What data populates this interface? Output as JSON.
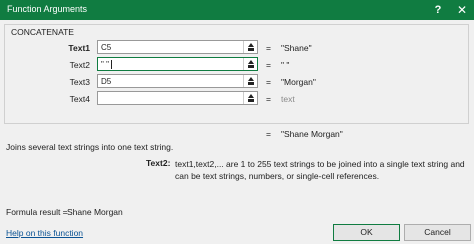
{
  "window": {
    "title": "Function Arguments",
    "help_label": "?",
    "close_label": "✕"
  },
  "function_name": "CONCATENATE",
  "arguments": [
    {
      "label": "Text1",
      "value": "C5",
      "result": "\"Shane\"",
      "bold": true
    },
    {
      "label": "Text2",
      "value": "\" \"",
      "result": "\" \"",
      "bold": false
    },
    {
      "label": "Text3",
      "value": "D5",
      "result": "\"Morgan\"",
      "bold": false
    },
    {
      "label": "Text4",
      "value": "",
      "result": "text",
      "bold": false
    }
  ],
  "equals_sign": "=",
  "formula_value": "\"Shane Morgan\"",
  "description": "Joins several text strings into one text string.",
  "arg_help": {
    "label": "Text2:",
    "text": "text1,text2,... are 1 to 255 text strings to be joined into a single text string and can be text strings, numbers, or single-cell references."
  },
  "formula_result": {
    "label": "Formula result =",
    "value": "Shane Morgan"
  },
  "help_link": "Help on this function",
  "buttons": {
    "ok": "OK",
    "cancel": "Cancel"
  },
  "colors": {
    "title_bar": "#107c41",
    "link": "#0b5394"
  },
  "icons": {
    "collapse": "collapse-dialog-icon"
  }
}
